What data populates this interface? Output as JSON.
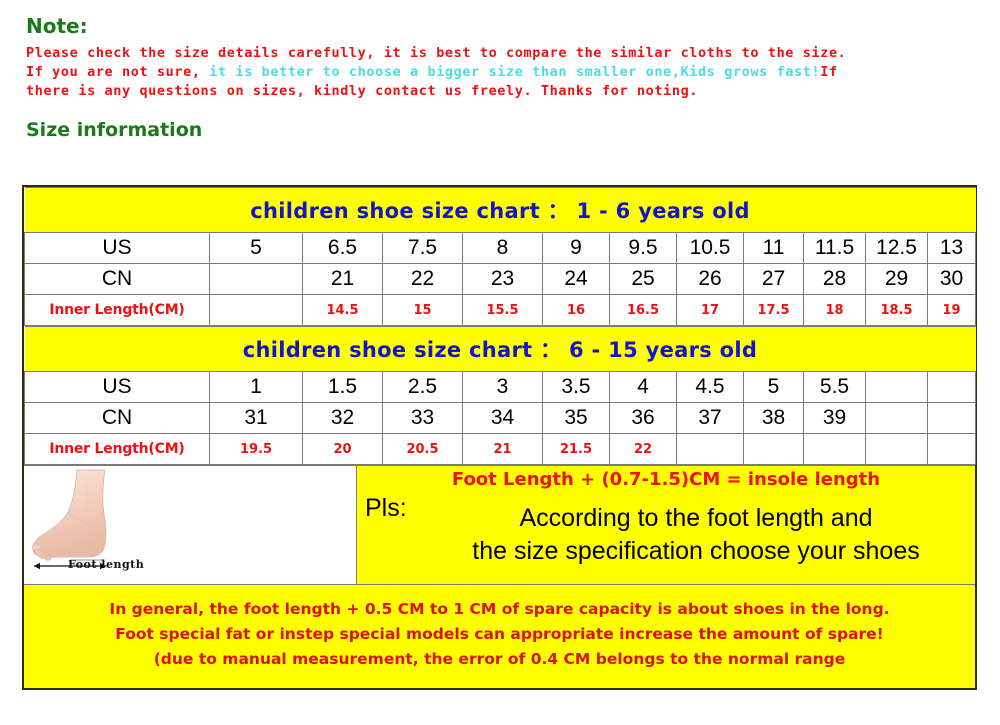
{
  "note": {
    "title": "Note:",
    "line1": "Please check the size details carefully, it is best to compare the similar cloths to the size.",
    "line2_red_start": "If you are not sure,",
    "line2_cyan": " it is better to choose a bigger size than smaller one,Kids grows fast!",
    "line2_red_end": "If",
    "line3": "there is any questions on sizes, kindly contact us freely. Thanks for noting."
  },
  "size_information_heading": "Size information",
  "colors": {
    "note_red": "#ee1111",
    "note_cyan": "#4ddbdb",
    "heading_green": "#1a7a1a",
    "band_yellow": "#ffff00",
    "band_blue": "#1414c8",
    "value_red": "#ee1111"
  },
  "chart_data": {
    "type": "table",
    "title": "children shoe size chart",
    "tables": [
      {
        "band_title": "children  shoe size chart ：  1 - 6 years old",
        "columns": 12,
        "rows": [
          {
            "label": "US",
            "style": "black",
            "values": [
              "5",
              "6.5",
              "7.5",
              "8",
              "9",
              "9.5",
              "10.5",
              "11",
              "11.5",
              "12.5",
              "13"
            ]
          },
          {
            "label": "CN",
            "style": "black",
            "values": [
              "",
              "21",
              "22",
              "23",
              "24",
              "25",
              "26",
              "27",
              "28",
              "29",
              "30"
            ]
          },
          {
            "label": "Inner Length(CM)",
            "style": "red",
            "values": [
              "",
              "14.5",
              "15",
              "15.5",
              "16",
              "16.5",
              "17",
              "17.5",
              "18",
              "18.5",
              "19"
            ]
          }
        ]
      },
      {
        "band_title": "children  shoe size chart ：  6 - 15 years old",
        "columns": 12,
        "rows": [
          {
            "label": "US",
            "style": "black",
            "values": [
              "1",
              "1.5",
              "2.5",
              "3",
              "3.5",
              "4",
              "4.5",
              "5",
              "5.5",
              "",
              ""
            ]
          },
          {
            "label": "CN",
            "style": "black",
            "values": [
              "31",
              "32",
              "33",
              "34",
              "35",
              "36",
              "37",
              "38",
              "39",
              "",
              ""
            ]
          },
          {
            "label": "Inner Length(CM)",
            "style": "red",
            "values": [
              "19.5",
              "20",
              "20.5",
              "21",
              "21.5",
              "22",
              "",
              "",
              "",
              "",
              ""
            ]
          }
        ]
      }
    ]
  },
  "foot_section": {
    "image_label": "Foot length",
    "pls_word": "Pls:",
    "formula": "Foot Length + (0.7-1.5)CM = insole length",
    "body_line1": "According to the foot length and",
    "body_line2": "the size specification choose your shoes"
  },
  "bottom_note": {
    "line1": "In general, the foot length + 0.5 CM to 1 CM of spare capacity is about shoes in the long.",
    "line2": "Foot special fat or instep special models can appropriate increase the amount of spare!",
    "line3": "(due to manual measurement, the error of 0.4 CM belongs to the normal range"
  }
}
